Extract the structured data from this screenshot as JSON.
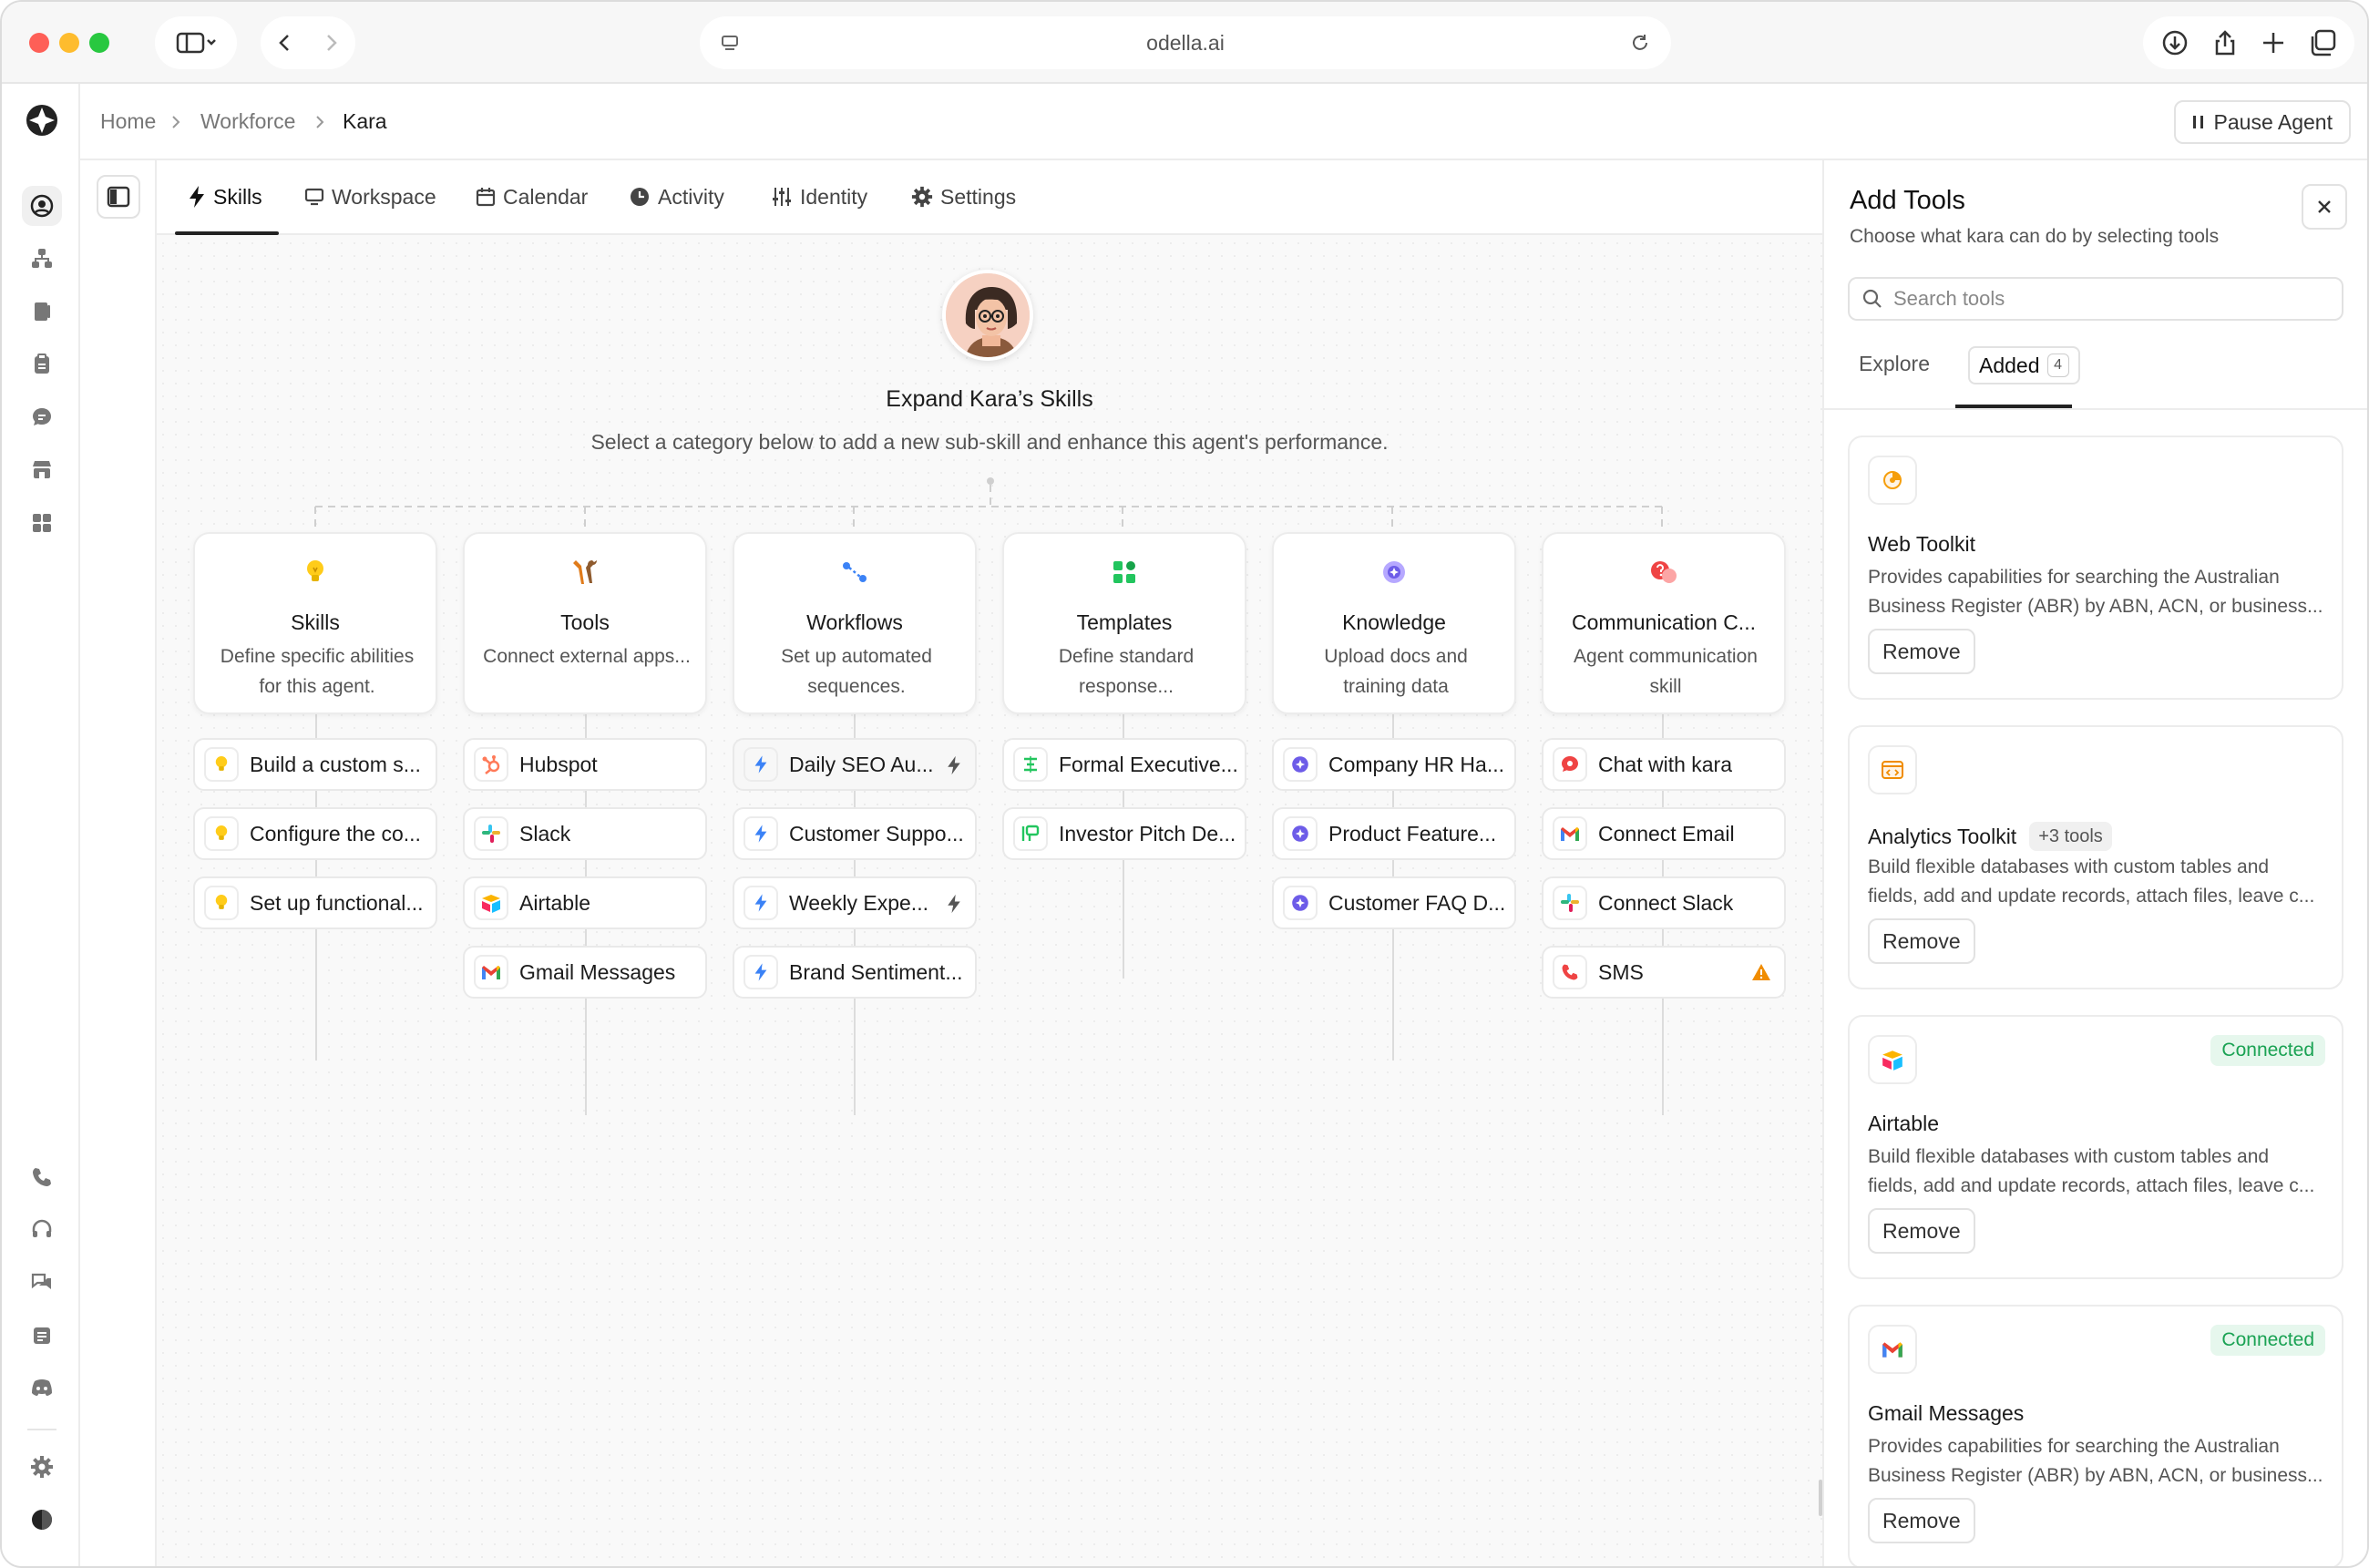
{
  "browser": {
    "url": "odella.ai"
  },
  "breadcrumb": {
    "home": "Home",
    "workforce": "Workforce",
    "current": "Kara"
  },
  "topbar": {
    "pause_label": "Pause Agent"
  },
  "tabs": [
    {
      "label": "Skills",
      "icon": "bolt-icon"
    },
    {
      "label": "Workspace",
      "icon": "monitor-icon"
    },
    {
      "label": "Calendar",
      "icon": "calendar-icon"
    },
    {
      "label": "Activity",
      "icon": "clock-icon"
    },
    {
      "label": "Identity",
      "icon": "sliders-icon"
    },
    {
      "label": "Settings",
      "icon": "gear-icon"
    }
  ],
  "hero": {
    "title": "Expand Kara’s Skills",
    "subtitle": "Select a category below to add a new sub-skill and enhance this agent's performance."
  },
  "categories": [
    {
      "title": "Skills",
      "desc": "Define specific abilities for this agent.",
      "items": [
        "Build a custom s...",
        "Configure the co...",
        "Set up functional..."
      ]
    },
    {
      "title": "Tools",
      "desc": "Connect external apps...",
      "items": [
        "Hubspot",
        "Slack",
        "Airtable",
        "Gmail Messages"
      ]
    },
    {
      "title": "Workflows",
      "desc": "Set up automated sequences.",
      "items": [
        "Daily SEO Au...",
        "Customer Suppo...",
        "Weekly Expe...",
        "Brand Sentiment..."
      ]
    },
    {
      "title": "Templates",
      "desc": "Define standard response...",
      "items": [
        "Formal Executive...",
        "Investor Pitch De..."
      ]
    },
    {
      "title": "Knowledge",
      "desc": "Upload docs and training data",
      "items": [
        "Company HR Ha...",
        "Product Feature...",
        "Customer FAQ D..."
      ]
    },
    {
      "title": "Communication C...",
      "desc": "Agent communication skill",
      "items": [
        "Chat with kara",
        "Connect Email",
        "Connect Slack",
        "SMS"
      ]
    }
  ],
  "panel": {
    "title": "Add Tools",
    "subtitle": "Choose what kara can do by selecting tools",
    "search_placeholder": "Search tools",
    "tab_explore": "Explore",
    "tab_added": "Added",
    "added_count": "4",
    "remove_label": "Remove",
    "tools": [
      {
        "name": "Web Toolkit",
        "desc": "Provides capabilities for searching the Australian\nBusiness Register (ABR) by ABN, ACN, or business...",
        "extra": "",
        "status": ""
      },
      {
        "name": "Analytics Toolkit",
        "desc": "Build flexible databases with custom tables and\nfields, add and update records, attach files, leave c...",
        "extra": "+3 tools",
        "status": ""
      },
      {
        "name": "Airtable",
        "desc": "Build flexible databases with custom tables and\nfields, add and update records, attach files, leave c...",
        "extra": "",
        "status": "Connected"
      },
      {
        "name": "Gmail Messages",
        "desc": "Provides capabilities for searching the Australian\nBusiness Register (ABR) by ABN, ACN, or business...",
        "extra": "",
        "status": "Connected"
      }
    ]
  },
  "colors": {
    "connected_bg": "#e6f7ed",
    "connected_text": "#1aa253",
    "workflow_blue": "#3b82f6",
    "knowledge_purple": "#6d5ce8",
    "warning": "#f08c00"
  }
}
